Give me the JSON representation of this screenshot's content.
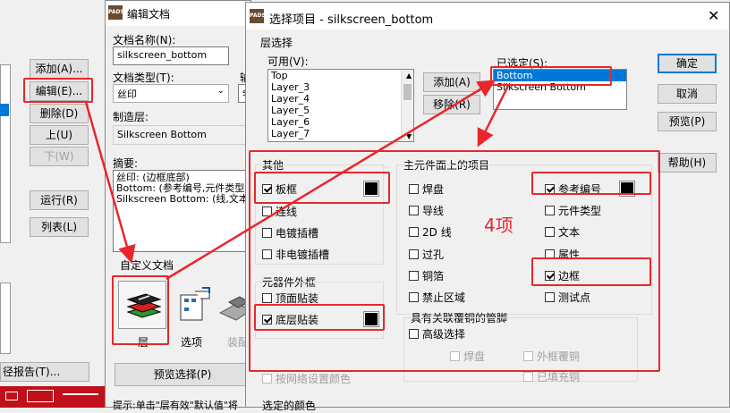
{
  "left_window": {
    "buttons": {
      "add": "添加(A)...",
      "edit": "编辑(E)...",
      "delete": "删除(D)",
      "up": "上(U)",
      "down": "下(W)",
      "run": "运行(R)",
      "list": "列表(L)"
    },
    "bottom_text": "径报告(T)..."
  },
  "edit_doc": {
    "title": "编辑文档",
    "doc_name_label": "文档名称(N):",
    "doc_name_value": "silkscreen_bottom",
    "doc_type_label": "文档类型(T):",
    "doc_type_value": "丝印",
    "output_label_partial": "输",
    "output_value_partial": "s",
    "layer_label": "制造层:",
    "layer_value": "Silkscreen Bottom",
    "summary_label": "摘要:",
    "summary_lines": [
      "丝印: (边框底部)",
      "Bottom: (参考编号,元件类型)",
      "Silkscreen Bottom: (线,文本,边"
    ],
    "custom_doc_label": "自定义文档",
    "icon_layer_label": "层",
    "icon_options_label": "选项",
    "icon_assembly_label": "装配",
    "preview_button": "预览选择(P)",
    "hint_text": "提示:单击\"层有效\"默认值\"将"
  },
  "select_dialog": {
    "title": "选择项目 - silkscreen_bottom",
    "layer_select_label": "层选择",
    "available_label": "可用(V):",
    "available_items": [
      "Top",
      "Layer_3",
      "Layer_4",
      "Layer_5",
      "Layer_6",
      "Layer_7"
    ],
    "add_button": "添加(A)",
    "remove_button": "移除(R)",
    "selected_label": "已选定(S):",
    "selected_items": [
      "Bottom",
      "Silkscreen Bottom"
    ],
    "ok_button": "确定",
    "cancel_button": "取消",
    "preview_button": "预览(P)",
    "help_button": "帮助(H)",
    "other_group": "其他",
    "board_frame": "板框",
    "connection": "连线",
    "plated_slot": "电镀插槽",
    "nonplated_slot": "非电镀插槽",
    "component_outline_group": "元器件外框",
    "top_mount": "顶面贴装",
    "bottom_mount": "底层贴装",
    "net_color": "按网络设置颜色",
    "main_items_group": "主元件面上的项目",
    "pad": "焊盘",
    "trace": "导线",
    "line_2d": "2D 线",
    "via": "过孔",
    "copper": "铜箔",
    "keepout": "禁止区域",
    "ref_des": "参考编号",
    "part_type": "元件类型",
    "text": "文本",
    "attribute": "属性",
    "outline": "边框",
    "testpoint": "测试点",
    "copper_pins_group": "具有关联覆铜的管脚",
    "advanced_select": "高级选择",
    "pads_sub": "焊盘",
    "outline_copper": "外框覆铜",
    "filled": "已填充铜",
    "selected_color_label": "选定的颜色",
    "annotation": "4项"
  }
}
